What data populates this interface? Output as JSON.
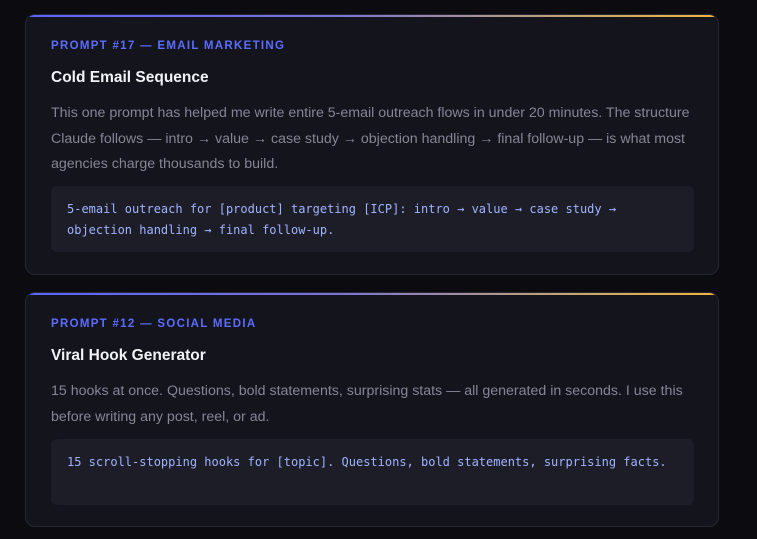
{
  "cards": [
    {
      "label": "PROMPT #17 — EMAIL MARKETING",
      "title": "Cold Email Sequence",
      "body": "This one prompt has helped me write entire 5-email outreach flows in under 20 minutes. The structure Claude follows — intro → value → case study → objection handling → final follow-up — is what most agencies charge thousands to build.",
      "code": "5-email outreach for [product] targeting [ICP]: intro → value → case study → objection handling → final follow-up."
    },
    {
      "label": "PROMPT #12 — SOCIAL MEDIA",
      "title": "Viral Hook Generator",
      "body": "15 hooks at once. Questions, bold statements, surprising stats — all generated in seconds. I use this before writing any post, reel, or ad.",
      "code": "15 scroll-stopping hooks for [topic]. Questions, bold statements, surprising facts."
    }
  ],
  "colors": {
    "background": "#0b0b10",
    "card": "#14141d",
    "label": "#5c6cff",
    "title": "#f2f2f6",
    "body": "#858595",
    "code_bg": "#1d1d28",
    "code_text": "#9fb4ff",
    "accent_gradient_start": "#5a64ff",
    "accent_gradient_end": "#f1b43c"
  }
}
